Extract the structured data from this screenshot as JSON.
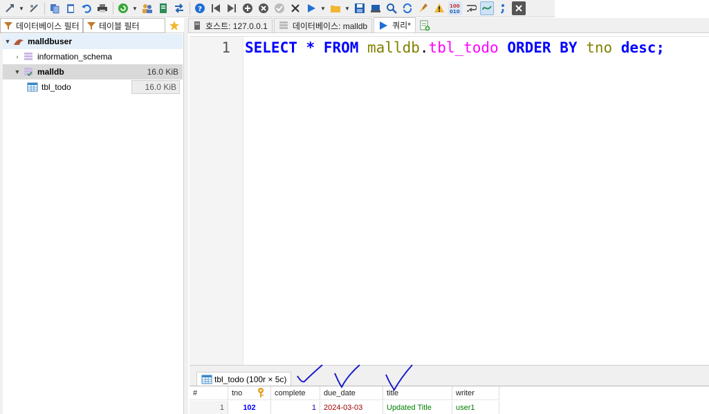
{
  "toolbar": {
    "buttons": [
      "connect-icon",
      "disconnect-icon",
      "copy-icon",
      "paste-icon",
      "undo-icon",
      "print-icon",
      "refresh-icon",
      "user-manager-icon",
      "export-icon",
      "transfer-icon",
      "help-icon",
      "first-icon",
      "last-icon",
      "add-icon",
      "cancel-icon",
      "check-icon",
      "delete-icon",
      "run-icon",
      "open-folder-icon",
      "save-icon",
      "save-as-icon",
      "find-icon",
      "find-replace-icon",
      "clean-icon",
      "warning-icon",
      "binary-icon",
      "wrap-icon",
      "format-icon",
      "semicolon-icon",
      "close-icon"
    ]
  },
  "left": {
    "db_filter_placeholder": "데이터베이스 필터",
    "table_filter_placeholder": "테이블 필터",
    "tree": {
      "root": "malldbuser",
      "dbs": [
        {
          "name": "information_schema",
          "size": ""
        },
        {
          "name": "malldb",
          "size": "16.0 KiB"
        }
      ],
      "tables": [
        {
          "name": "tbl_todo",
          "size": "16.0 KiB"
        }
      ]
    }
  },
  "tabs": [
    {
      "label": "호스트: 127.0.0.1",
      "icon": "host-icon"
    },
    {
      "label": "데이터베이스: malldb",
      "icon": "database-icon"
    },
    {
      "label": "쿼리*",
      "icon": "run-icon"
    }
  ],
  "editor": {
    "line_number": "1",
    "tokens": {
      "select": "SELECT",
      "star": " * ",
      "from": "FROM",
      "sp1": " ",
      "db": "malldb",
      "dot": ".",
      "table": "tbl_todo",
      "sp2": " ",
      "order": "ORDER",
      "sp3": " ",
      "by": "BY",
      "sp4": " ",
      "col": "tno",
      "sp5": " ",
      "desc": "desc",
      "semi": ";"
    }
  },
  "result": {
    "tab_label": "tbl_todo (100r × 5c)",
    "columns": [
      "#",
      "tno",
      "complete",
      "due_date",
      "title",
      "writer"
    ],
    "rows": [
      {
        "rownum": "1",
        "tno": "102",
        "complete": "1",
        "due_date": "2024-03-03",
        "title": "Updated Title",
        "writer": "user1"
      }
    ]
  },
  "colors": {
    "keyword": "#0000ff",
    "identifier": "#808000",
    "table": "#ff00ff",
    "annotation": "#1a1acc"
  }
}
